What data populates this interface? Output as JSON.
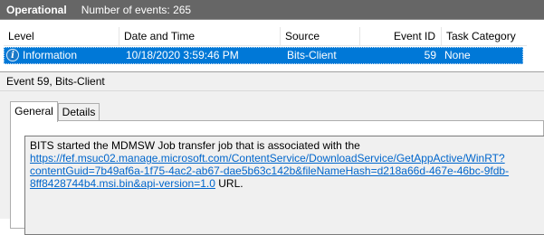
{
  "log_header": {
    "name": "Operational",
    "count_text": "Number of events: 265"
  },
  "columns": [
    "Level",
    "Date and Time",
    "Source",
    "Event ID",
    "Task Category"
  ],
  "rows": [
    {
      "level": "Information",
      "level_icon": "info-icon",
      "datetime": "10/18/2020 3:59:46 PM",
      "source": "Bits-Client",
      "event_id": "59",
      "task_category": "None"
    }
  ],
  "detail": {
    "title": "Event 59, Bits-Client",
    "tabs": [
      {
        "label": "General",
        "active": true
      },
      {
        "label": "Details",
        "active": false
      }
    ],
    "message_prefix": "BITS started the MDMSW Job transfer job that is associated with the",
    "url_lines": [
      "https://fef.msuc02.manage.microsoft.com/ContentService/DownloadService/GetAppActive/WinRT?",
      "contentGuid=7b49af6a-1f75-4ac2-ab67-dae5b63c142b&fileNameHash=d218a66d-467e-46bc-9fdb-",
      "8ff8428744b4.msi.bin&api-version=1.0"
    ],
    "message_suffix": " URL."
  },
  "colors": {
    "header_bg": "#666666",
    "selection": "#0078d7",
    "link": "#0066cc",
    "panel_bg": "#f0f0f0"
  }
}
